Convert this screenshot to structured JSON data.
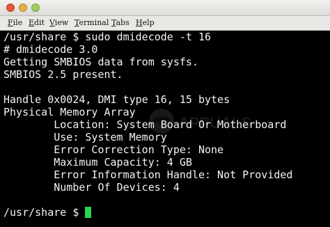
{
  "menu": {
    "items": [
      {
        "mnemonic": "F",
        "rest": "ile"
      },
      {
        "mnemonic": "E",
        "rest": "dit"
      },
      {
        "mnemonic": "V",
        "rest": "iew"
      },
      {
        "mnemonic": "T",
        "rest": "erminal"
      },
      {
        "mnemonic": "T",
        "rest": "abs"
      },
      {
        "mnemonic": "H",
        "rest": "elp"
      }
    ]
  },
  "terminal": {
    "lines": [
      "/usr/share $ sudo dmidecode -t 16",
      "# dmidecode 3.0",
      "Getting SMBIOS data from sysfs.",
      "SMBIOS 2.5 present.",
      "",
      "Handle 0x0024, DMI type 16, 15 bytes",
      "Physical Memory Array",
      "        Location: System Board Or Motherboard",
      "        Use: System Memory",
      "        Error Correction Type: None",
      "        Maximum Capacity: 4 GB",
      "        Error Information Handle: Not Provided",
      "        Number Of Devices: 4",
      ""
    ],
    "prompt": "/usr/share $ "
  },
  "watermark": {
    "text": "APPUALS"
  },
  "colors": {
    "background": "#000000",
    "text": "#f4f4f4",
    "cursor": "#29d64e",
    "menubar": "#e9e8e5"
  }
}
